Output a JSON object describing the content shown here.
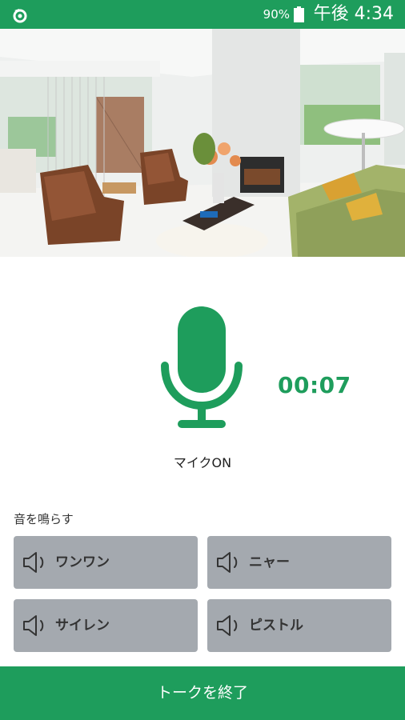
{
  "status_bar": {
    "battery_percent": "90%",
    "time": "午後 4:34",
    "left_icon": "app-notification-icon",
    "battery_icon": "battery-icon"
  },
  "camera_view": {
    "description_icon": "live-camera-feed"
  },
  "talk": {
    "mic_icon": "microphone-icon",
    "timer": "00:07",
    "mic_status": "マイクON"
  },
  "sounds": {
    "section_label": "音を鳴らす",
    "buttons": [
      {
        "label": "ワンワン",
        "icon": "speaker-icon"
      },
      {
        "label": "ニャー",
        "icon": "speaker-icon"
      },
      {
        "label": "サイレン",
        "icon": "speaker-icon"
      },
      {
        "label": "ピストル",
        "icon": "speaker-icon"
      }
    ]
  },
  "footer": {
    "end_talk_label": "トークを終了"
  },
  "colors": {
    "accent": "#1e9d5c",
    "button_gray": "#a4a9af"
  }
}
